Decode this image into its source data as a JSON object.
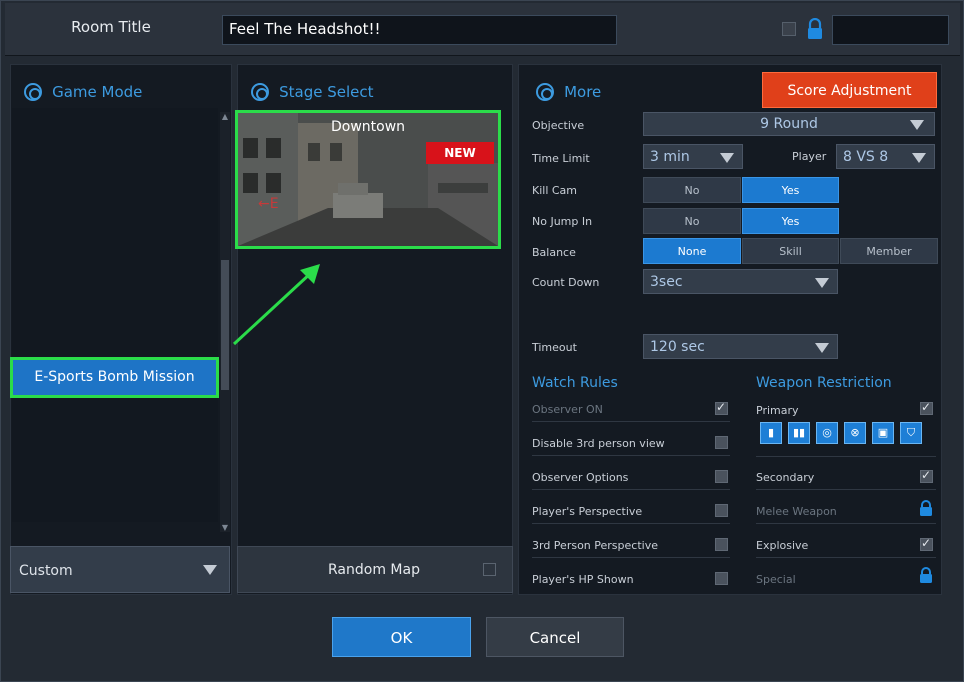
{
  "header": {
    "room_title_label": "Room Title",
    "room_title_value": "Feel The Headshot!!"
  },
  "game_mode": {
    "title": "Game Mode",
    "selected_mode": "E-Sports Bomb Mission",
    "preset": "Custom"
  },
  "stage": {
    "title": "Stage Select",
    "map_name": "Downtown",
    "badge": "NEW",
    "random_map_label": "Random Map"
  },
  "more": {
    "title": "More",
    "score_adjustment": "Score Adjustment",
    "objective_label": "Objective",
    "objective_value": "9 Round",
    "time_limit_label": "Time Limit",
    "time_limit_value": "3 min",
    "player_label": "Player",
    "player_value": "8 VS 8",
    "kill_cam_label": "Kill Cam",
    "no_jump_label": "No Jump In",
    "balance_label": "Balance",
    "count_down_label": "Count Down",
    "count_down_value": "3sec",
    "timeout_label": "Timeout",
    "timeout_value": "120 sec",
    "no": "No",
    "yes": "Yes",
    "balance_none": "None",
    "balance_skill": "Skill",
    "balance_member": "Member"
  },
  "watch_rules": {
    "title": "Watch Rules",
    "items": [
      {
        "label": "Observer ON"
      },
      {
        "label": "Disable 3rd person view"
      },
      {
        "label": "Observer Options"
      },
      {
        "label": "Player's Perspective"
      },
      {
        "label": "3rd Person Perspective"
      },
      {
        "label": "Player's HP Shown"
      }
    ]
  },
  "weapon_restriction": {
    "title": "Weapon Restriction",
    "primary": "Primary",
    "secondary": "Secondary",
    "melee": "Melee Weapon",
    "explosive": "Explosive",
    "special": "Special"
  },
  "footer": {
    "ok": "OK",
    "cancel": "Cancel"
  },
  "colors": {
    "accent_blue": "#1c7ad0",
    "highlight_green": "#2bdc4a",
    "score_orange": "#e0401a",
    "new_red": "#d8121a"
  }
}
